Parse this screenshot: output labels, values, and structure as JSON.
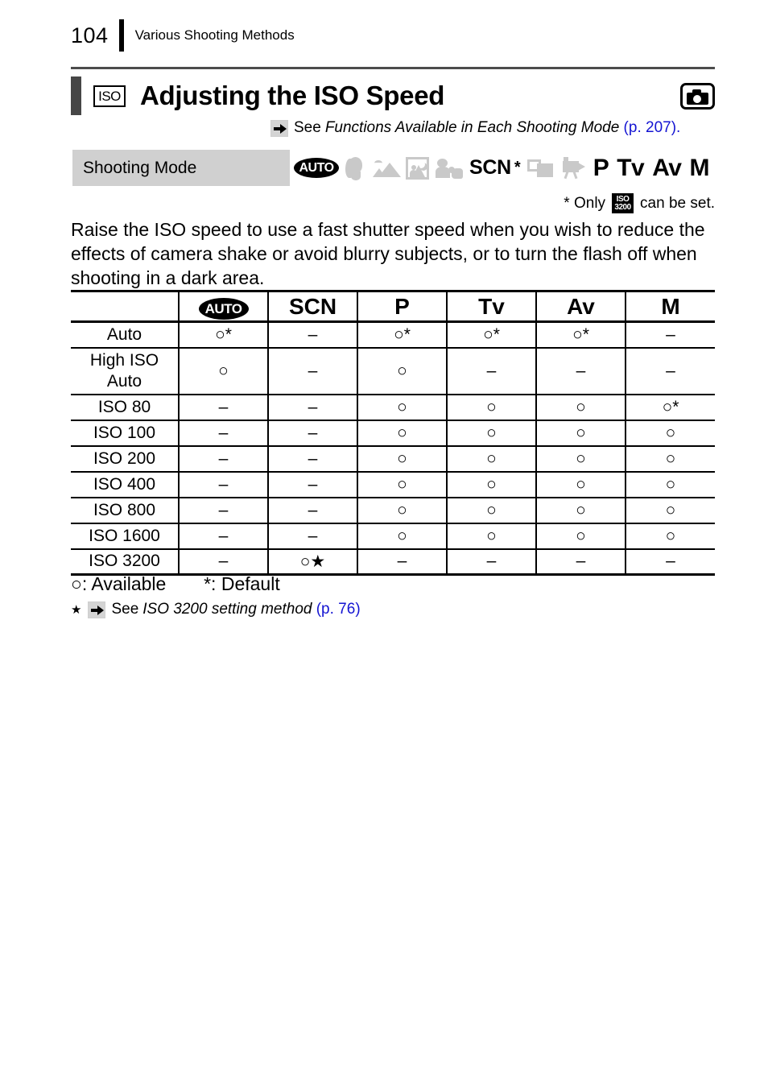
{
  "header": {
    "page_number": "104",
    "title": "Various Shooting Methods"
  },
  "section": {
    "icon_label": "ISO",
    "title": "Adjusting the ISO Speed",
    "mode_badge_icon": "camera-icon"
  },
  "see_reference": {
    "arrow_icon": "arrow-right-icon",
    "see_word": "See",
    "italic_text": "Functions Available in Each Shooting Mode",
    "page_ref": "(p. 207).",
    "page_ref_color": "#1414d2"
  },
  "shooting_mode_bar": {
    "label": "Shooting Mode",
    "background": "#d0d0d0",
    "modes": [
      {
        "name": "auto",
        "label": "AUTO",
        "style": "oval-black",
        "available": true
      },
      {
        "name": "portrait",
        "label": "",
        "style": "gray-icon",
        "available": false
      },
      {
        "name": "landscape",
        "label": "",
        "style": "gray-icon",
        "available": false
      },
      {
        "name": "night-snapshot",
        "label": "",
        "style": "gray-icon",
        "available": false
      },
      {
        "name": "kids-and-pets",
        "label": "",
        "style": "gray-icon",
        "available": false
      },
      {
        "name": "scn",
        "label": "SCN",
        "superscript": "*",
        "style": "bold-text",
        "available": true
      },
      {
        "name": "stitch-assist",
        "label": "",
        "style": "gray-icon",
        "available": false
      },
      {
        "name": "movie",
        "label": "",
        "style": "gray-icon",
        "available": false
      },
      {
        "name": "p",
        "label": "P",
        "style": "bold-text",
        "available": true
      },
      {
        "name": "tv",
        "label": "Tv",
        "style": "bold-text",
        "available": true
      },
      {
        "name": "av",
        "label": "Av",
        "style": "bold-text",
        "available": true
      },
      {
        "name": "m",
        "label": "M",
        "style": "bold-text",
        "available": true
      }
    ]
  },
  "only_note": {
    "prefix": "* Only",
    "chip_top": "ISO",
    "chip_bottom": "3200",
    "suffix": "can be set."
  },
  "body_paragraph": "Raise the ISO speed to use a fast shutter speed when you wish to reduce the effects of camera shake or avoid blurry subjects, or to turn the flash off when shooting in a dark area.",
  "table": {
    "columns": [
      "",
      "AUTO",
      "SCN",
      "P",
      "Tv",
      "Av",
      "M"
    ],
    "rows": [
      {
        "label": "Auto",
        "cells": [
          "○*",
          "–",
          "○*",
          "○*",
          "○*",
          "–"
        ]
      },
      {
        "label": "High ISO\nAuto",
        "label_line1": "High ISO",
        "label_line2": "Auto",
        "cells": [
          "○",
          "–",
          "○",
          "–",
          "–",
          "–"
        ]
      },
      {
        "label": "ISO 80",
        "cells": [
          "–",
          "–",
          "○",
          "○",
          "○",
          "○*"
        ]
      },
      {
        "label": "ISO 100",
        "cells": [
          "–",
          "–",
          "○",
          "○",
          "○",
          "○"
        ]
      },
      {
        "label": "ISO 200",
        "cells": [
          "–",
          "–",
          "○",
          "○",
          "○",
          "○"
        ]
      },
      {
        "label": "ISO 400",
        "cells": [
          "–",
          "–",
          "○",
          "○",
          "○",
          "○"
        ]
      },
      {
        "label": "ISO 800",
        "cells": [
          "–",
          "–",
          "○",
          "○",
          "○",
          "○"
        ]
      },
      {
        "label": "ISO 1600",
        "cells": [
          "–",
          "–",
          "○",
          "○",
          "○",
          "○"
        ]
      },
      {
        "label": "ISO 3200",
        "cells": [
          "–",
          "○★",
          "–",
          "–",
          "–",
          "–"
        ]
      }
    ]
  },
  "legend": {
    "available": "○: Available",
    "default": "*: Default"
  },
  "star_note": {
    "star": "★",
    "arrow_icon": "arrow-right-icon",
    "see_word": "See",
    "italic_text": "ISO 3200 setting method",
    "page_ref": "(p. 76)",
    "page_ref_color": "#1414d2"
  }
}
